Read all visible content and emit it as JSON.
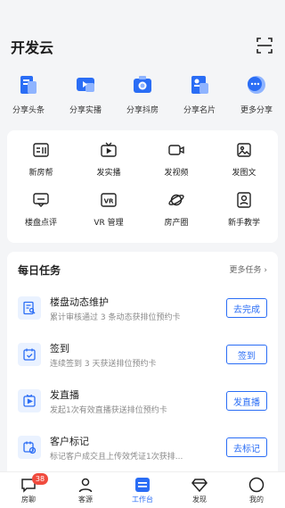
{
  "header": {
    "title": "开发云"
  },
  "share": [
    {
      "label": "分享头条",
      "icon": "headline-icon"
    },
    {
      "label": "分享实播",
      "icon": "live-video-icon"
    },
    {
      "label": "分享抖房",
      "icon": "camera-icon"
    },
    {
      "label": "分享名片",
      "icon": "business-card-icon"
    },
    {
      "label": "更多分享",
      "icon": "chat-bubble-icon"
    }
  ],
  "grid": [
    {
      "label": "新房帮",
      "icon": "new-house-icon"
    },
    {
      "label": "发实播",
      "icon": "tv-icon"
    },
    {
      "label": "发视频",
      "icon": "video-camera-icon"
    },
    {
      "label": "发图文",
      "icon": "image-icon"
    },
    {
      "label": "楼盘点评",
      "icon": "comment-icon"
    },
    {
      "label": "VR 管理",
      "icon": "vr-icon"
    },
    {
      "label": "房产圈",
      "icon": "planet-icon"
    },
    {
      "label": "新手教学",
      "icon": "tutorial-icon"
    }
  ],
  "tasks": {
    "title": "每日任务",
    "more": "更多任务",
    "items": [
      {
        "title": "楼盘动态维护",
        "desc": "累计审核通过 3 条动态获排位预约卡",
        "button": "去完成",
        "icon": "document-search-icon"
      },
      {
        "title": "签到",
        "desc": "连续签到 3 天获送排位预约卡",
        "button": "签到",
        "icon": "calendar-check-icon"
      },
      {
        "title": "发直播",
        "desc": "发起1次有效直播获送排位预约卡",
        "button": "发直播",
        "icon": "live-play-icon"
      },
      {
        "title": "客户标记",
        "desc": "标记客户成交且上传效凭证1次获排...",
        "button": "去标记",
        "icon": "calendar-clock-icon"
      }
    ]
  },
  "tabbar": {
    "items": [
      {
        "label": "房聊",
        "icon": "chat-icon",
        "badge": "38"
      },
      {
        "label": "客源",
        "icon": "person-icon"
      },
      {
        "label": "工作台",
        "icon": "workbench-icon",
        "active": true
      },
      {
        "label": "发现",
        "icon": "diamond-icon"
      },
      {
        "label": "我的",
        "icon": "profile-circle-icon"
      }
    ]
  },
  "colors": {
    "accent": "#2a6df5",
    "badge": "#f04b3e"
  }
}
